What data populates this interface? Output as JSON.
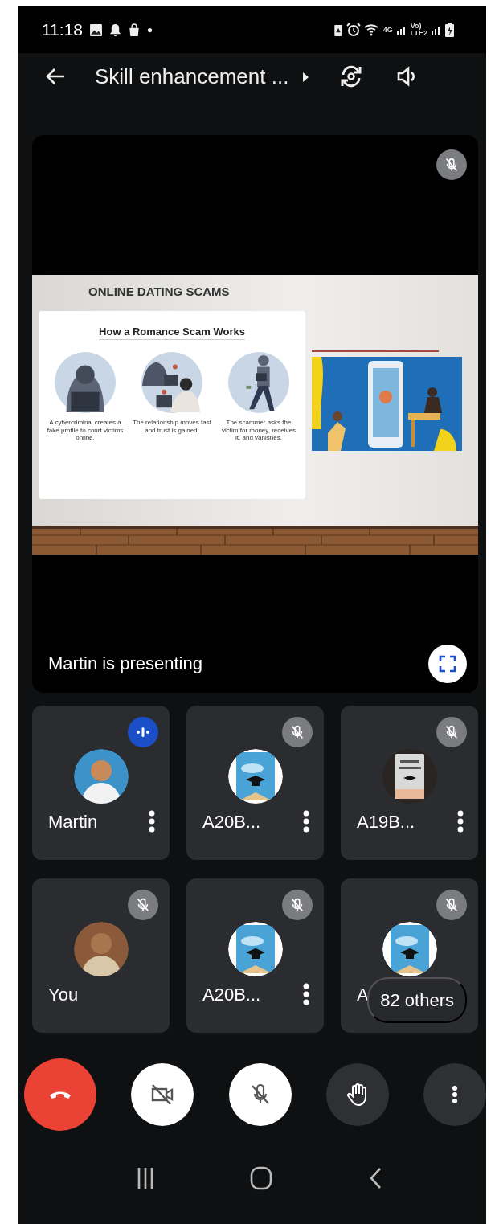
{
  "status_bar": {
    "time": "11:18",
    "network_labels": [
      "4G",
      "Vo)",
      "LTE2"
    ]
  },
  "header": {
    "title": "Skill enhancement ..."
  },
  "stage": {
    "muted": true,
    "caption": "Martin is presenting",
    "slide": {
      "title": "ONLINE DATING SCAMS",
      "heading": "How a Romance Scam Works",
      "steps": [
        {
          "caption": "A cybercriminal creates a fake profile to court victims online."
        },
        {
          "caption": "The relationship moves fast and trust is gained."
        },
        {
          "caption": "The scammer asks the victim for money, receives it, and vanishes."
        }
      ]
    }
  },
  "participants": [
    {
      "name": "Martin",
      "muted": false,
      "menu": true
    },
    {
      "name": "A20B...",
      "muted": true,
      "menu": true
    },
    {
      "name": "A19B...",
      "muted": true,
      "menu": true
    },
    {
      "name": "You",
      "muted": true,
      "menu": false
    },
    {
      "name": "A20B...",
      "muted": true,
      "menu": true
    },
    {
      "name": "A",
      "muted": true,
      "menu": false
    }
  ],
  "overflow": {
    "label": "82 others"
  },
  "controls": [
    {
      "kind": "end-call"
    },
    {
      "kind": "camera",
      "on": false
    },
    {
      "kind": "mic",
      "on": false
    },
    {
      "kind": "hand"
    },
    {
      "kind": "more"
    }
  ]
}
